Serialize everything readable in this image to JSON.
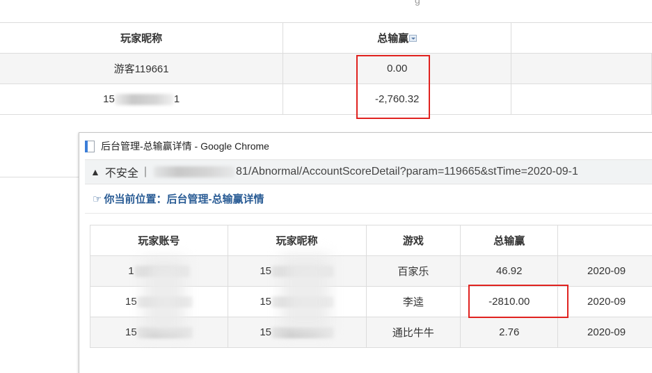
{
  "background_table": {
    "headers": [
      "玩家昵称",
      "总输赢"
    ],
    "rows": [
      {
        "nickname": "游客119661",
        "total": "0.00"
      },
      {
        "nickname": "15",
        "nickname_suffix": "1",
        "total": "-2,760.32"
      }
    ]
  },
  "popup": {
    "title": "后台管理-总输赢详情 - Google Chrome",
    "address": {
      "security_label": "不安全",
      "url_visible": "81/Abnormal/AccountScoreDetail?param=119665&stTime=2020-09-1"
    },
    "breadcrumb": "你当前位置：后台管理-总输赢详情",
    "table": {
      "headers": [
        "玩家账号",
        "玩家昵称",
        "游戏",
        "总输赢",
        ""
      ],
      "rows": [
        {
          "account": "1",
          "nickname": "15",
          "game": "百家乐",
          "total": "46.92",
          "date": "2020-09"
        },
        {
          "account": "15",
          "nickname": "15",
          "game": "李逵",
          "total": "-2810.00",
          "date": "2020-09"
        },
        {
          "account": "15",
          "nickname": "15",
          "game": "通比牛牛",
          "total": "2.76",
          "date": "2020-09"
        }
      ]
    }
  },
  "colors": {
    "highlight_box": "#e0221f",
    "breadcrumb_text": "#2a5c95"
  }
}
